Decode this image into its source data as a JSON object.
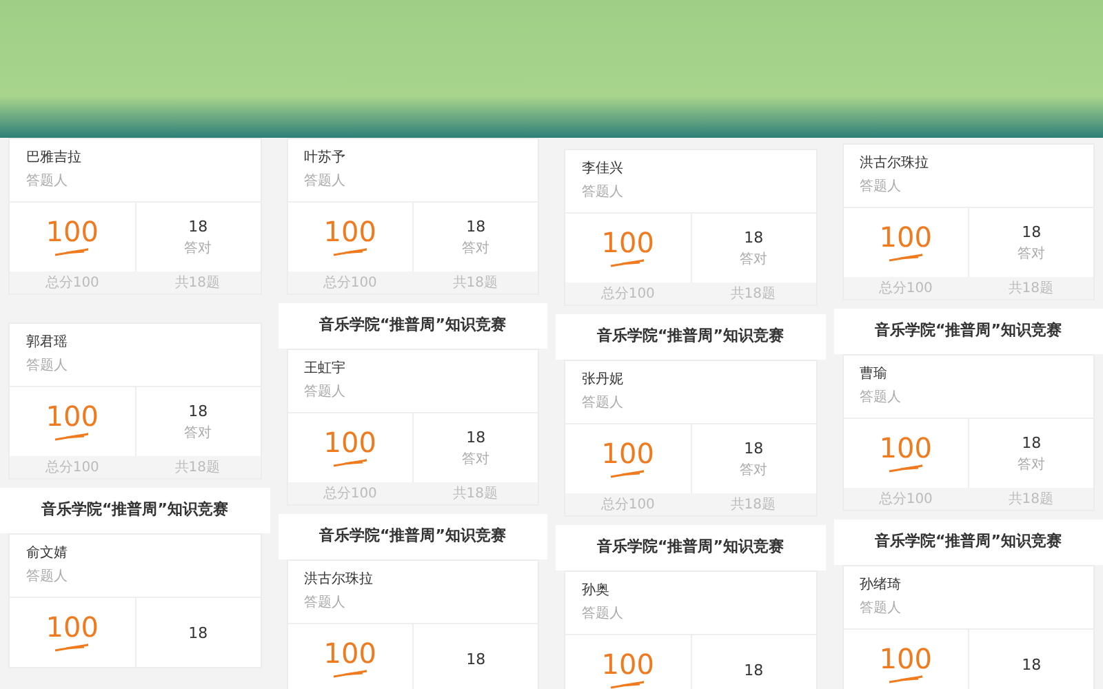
{
  "banner": {
    "kind": "illustration"
  },
  "columns": [
    {
      "segments": [
        {
          "kind": "card",
          "name": "巴雅吉拉",
          "role": "答题人",
          "score": "100",
          "correct": "18",
          "correct_label": "答对",
          "total_label": "总分100",
          "count_label": "共18题"
        },
        {
          "kind": "gap"
        },
        {
          "kind": "card",
          "name": "郭君瑶",
          "role": "答题人",
          "score": "100",
          "correct": "18",
          "correct_label": "答对",
          "total_label": "总分100",
          "count_label": "共18题"
        },
        {
          "kind": "title",
          "text": "音乐学院“推普周”知识竞赛"
        },
        {
          "kind": "card",
          "name": "俞文婧",
          "role": "答题人",
          "score": "100",
          "correct": "18"
        }
      ]
    },
    {
      "segments": [
        {
          "kind": "card",
          "name": "叶苏予",
          "role": "答题人",
          "score": "100",
          "correct": "18",
          "correct_label": "答对",
          "total_label": "总分100",
          "count_label": "共18题"
        },
        {
          "kind": "title",
          "text": "音乐学院“推普周”知识竞赛"
        },
        {
          "kind": "card",
          "name": "王虹宇",
          "role": "答题人",
          "score": "100",
          "correct": "18",
          "correct_label": "答对",
          "total_label": "总分100",
          "count_label": "共18题"
        },
        {
          "kind": "title",
          "text": "音乐学院“推普周”知识竞赛"
        },
        {
          "kind": "card",
          "name": "洪古尔珠拉",
          "role": "答题人",
          "score": "100",
          "correct": "18"
        }
      ]
    },
    {
      "segments": [
        {
          "kind": "card",
          "name": "李佳兴",
          "role": "答题人",
          "score": "100",
          "correct": "18",
          "correct_label": "答对",
          "total_label": "总分100",
          "count_label": "共18题"
        },
        {
          "kind": "title",
          "text": "音乐学院“推普周”知识竞赛"
        },
        {
          "kind": "card",
          "name": "张丹妮",
          "role": "答题人",
          "score": "100",
          "correct": "18",
          "correct_label": "答对",
          "total_label": "总分100",
          "count_label": "共18题"
        },
        {
          "kind": "title",
          "text": "音乐学院“推普周”知识竞赛"
        },
        {
          "kind": "card",
          "name": "孙奥",
          "role": "答题人",
          "score": "100",
          "correct": "18"
        }
      ]
    },
    {
      "segments": [
        {
          "kind": "card",
          "name": "洪古尔珠拉",
          "role": "答题人",
          "score": "100",
          "correct": "18",
          "correct_label": "答对",
          "total_label": "总分100",
          "count_label": "共18题"
        },
        {
          "kind": "title",
          "text": "音乐学院“推普周”知识竞赛"
        },
        {
          "kind": "card",
          "name": "曹瑜",
          "role": "答题人",
          "score": "100",
          "correct": "18",
          "correct_label": "答对",
          "total_label": "总分100",
          "count_label": "共18题"
        },
        {
          "kind": "title",
          "text": "音乐学院“推普周”知识竞赛"
        },
        {
          "kind": "card",
          "name": "孙绪琦",
          "role": "答题人",
          "score": "100",
          "correct": "18"
        }
      ]
    }
  ]
}
